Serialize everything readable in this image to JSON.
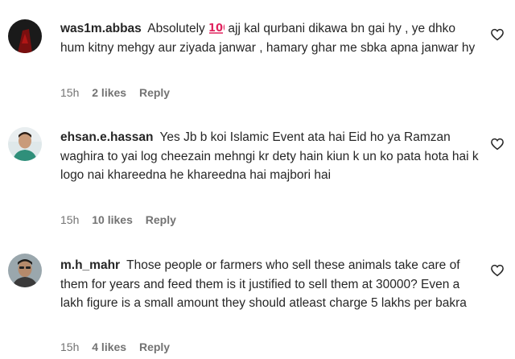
{
  "comments": [
    {
      "username": "was1m.abbas",
      "text_before_emoji": "Absolutely",
      "emoji": "hundred-points-icon",
      "text": "ajj kal qurbani dikawa bn gai hy , ye dhko hum kitny mehgy aur ziyada janwar , hamary ghar me sbka apna janwar hy",
      "time": "15h",
      "likes": "2 likes",
      "reply": "Reply"
    },
    {
      "username": "ehsan.e.hassan",
      "text": "Yes Jb b koi Islamic Event ata hai Eid ho ya Ramzan waghira to yai log cheezain mehngi kr dety hain kiun k un ko pata hota hai k logo nai khareedna he khareedna hai majbori hai",
      "time": "15h",
      "likes": "10 likes",
      "reply": "Reply"
    },
    {
      "username": "m.h_mahr",
      "text": "Those people or farmers who sell these animals take care of them for years and feed them is it justified to sell them at 30000? Even a lakh figure is a small amount they should atleast charge 5 lakhs per bakra",
      "time": "15h",
      "likes": "4 likes",
      "reply": "Reply"
    }
  ],
  "colors": {
    "text": "#262626",
    "meta": "#737373",
    "emoji_red": "#e0245e"
  }
}
